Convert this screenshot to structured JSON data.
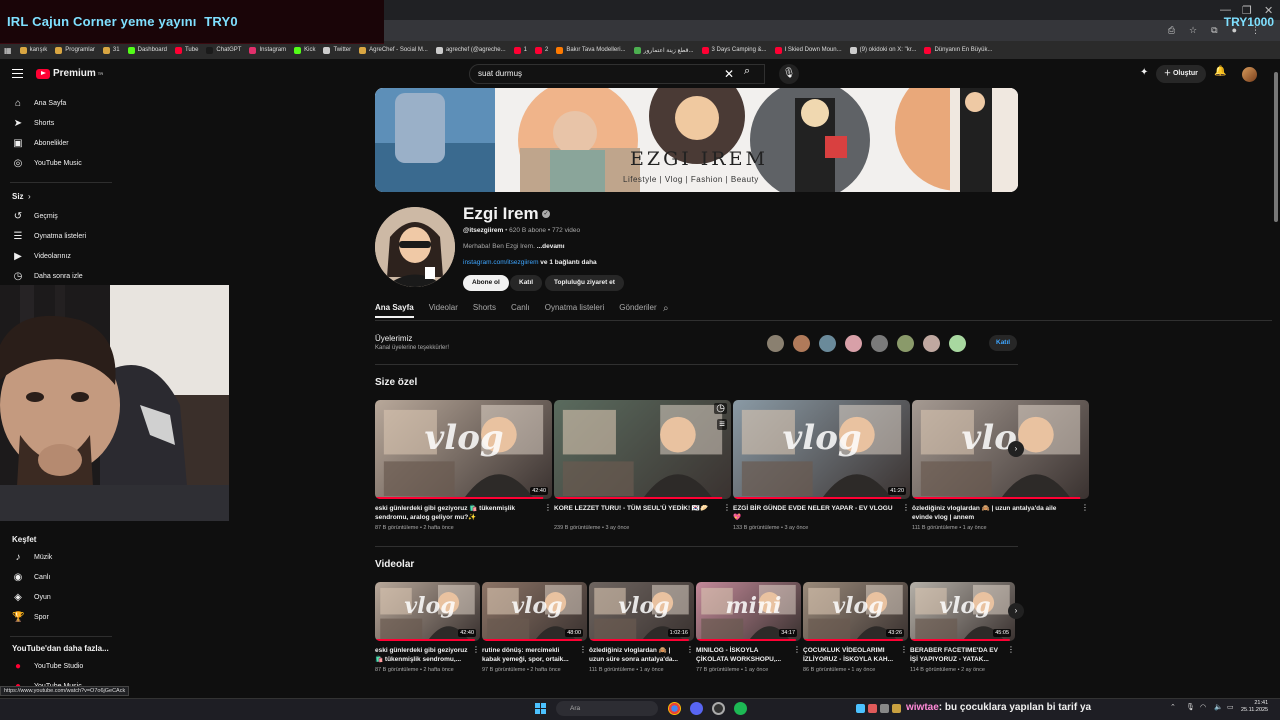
{
  "stream_overlay": {
    "title": "IRL Cajun Corner yeme yayını",
    "goal_current": "TRY0",
    "goal_target": "TRY1000"
  },
  "bookmarks": [
    {
      "label": "karışık",
      "color": "#d9a642"
    },
    {
      "label": "Programlar",
      "color": "#d9a642"
    },
    {
      "label": "31",
      "color": "#d9a642"
    },
    {
      "label": "Dashboard",
      "color": "#53fc18"
    },
    {
      "label": "Tube",
      "color": "#ff0033"
    },
    {
      "label": "ChatGPT",
      "color": "#1a1a1a"
    },
    {
      "label": "Instagram",
      "color": "#e1306c"
    },
    {
      "label": "Kick",
      "color": "#53fc18"
    },
    {
      "label": "Twitter",
      "color": "#cccccc"
    },
    {
      "label": "AgreChef - Social M...",
      "color": "#d9a642"
    },
    {
      "label": "agrechef (@agreche...",
      "color": "#cccccc"
    },
    {
      "label": "1",
      "color": "#ff0033"
    },
    {
      "label": "2",
      "color": "#ff0033"
    },
    {
      "label": "Bakır Tava Modelleri...",
      "color": "#ff7a00"
    },
    {
      "label": "قطع زينة اعتمارور...",
      "color": "#4caf50"
    },
    {
      "label": "3 Days Camping &...",
      "color": "#ff0033"
    },
    {
      "label": "I Skied Down Moun...",
      "color": "#ff0033"
    },
    {
      "label": "(9) okidoki on X: \"kr...",
      "color": "#cccccc"
    },
    {
      "label": "Dünyanın En Büyük...",
      "color": "#ff0033"
    }
  ],
  "header": {
    "logo_text": "Premium",
    "logo_sup": "TR",
    "search_value": "suat durmuş",
    "create_label": "Oluştur"
  },
  "sidebar": {
    "main": [
      {
        "label": "Ana Sayfa",
        "icon": "⌂"
      },
      {
        "label": "Shorts",
        "icon": "➤"
      },
      {
        "label": "Abonelikler",
        "icon": "▣"
      },
      {
        "label": "YouTube Music",
        "icon": "◎"
      }
    ],
    "you_title": "Siz",
    "you": [
      {
        "label": "Geçmiş",
        "icon": "↺"
      },
      {
        "label": "Oynatma listeleri",
        "icon": "☰"
      },
      {
        "label": "Videolarınız",
        "icon": "▶"
      },
      {
        "label": "Daha sonra izle",
        "icon": "◷"
      }
    ],
    "explore_title": "Keşfet",
    "explore": [
      {
        "label": "Müzik",
        "icon": "♪"
      },
      {
        "label": "Canlı",
        "icon": "◉"
      },
      {
        "label": "Oyun",
        "icon": "◈"
      },
      {
        "label": "Spor",
        "icon": "🏆"
      }
    ],
    "more_title": "YouTube'dan daha fazla...",
    "more": [
      {
        "label": "YouTube Studio"
      },
      {
        "label": "YouTube Music"
      }
    ]
  },
  "channel": {
    "banner_title": "EZGI IREM",
    "banner_subtitle": "Lifestyle | Vlog | Fashion | Beauty",
    "name": "Ezgi Irem",
    "handle": "@itsezgiirem",
    "meta": " • 620 B abone • 772 video",
    "desc": "Merhaba! Ben Ezgi Irem. ",
    "desc_more": "...devamı",
    "link": "instagram.com/itsezgiirem",
    "link_more": " ve 1 bağlantı daha",
    "subscribe_label": "Abone ol",
    "join_label": "Katıl",
    "community_label": "Topluluğu ziyaret et",
    "tabs": [
      "Ana Sayfa",
      "Videolar",
      "Shorts",
      "Canlı",
      "Oynatma listeleri",
      "Gönderiler"
    ],
    "members_title": "Üyelerimiz",
    "members_sub": "Kanal üyelerine teşekkürler!",
    "members_join": "Katıl"
  },
  "for_you": {
    "title": "Size özel",
    "videos": [
      {
        "title": "eski günlerdeki gibi geziyoruz 🛍️ tükenmişlik sendromu, aralog geliyor mu?✨",
        "views": "87 B görüntüleme",
        "age": "2 hafta önce",
        "duration": "42:40",
        "word": "vlog",
        "bg": "#b8a89a"
      },
      {
        "title": "KORE LEZZET TURU! - TÜM SEUL'Ü YEDİK! 🇰🇷🥟",
        "views": "239 B görüntüleme",
        "age": "3 ay önce",
        "duration": "",
        "word": "",
        "bg": "#5a6b5e"
      },
      {
        "title": "EZGİ BİR GÜNDE EVDE NELER YAPAR - EV VLOGU 💖",
        "views": "133 B görüntüleme",
        "age": "3 ay önce",
        "duration": "41:20",
        "word": "vlog",
        "bg": "#8a9aa5"
      },
      {
        "title": "özlediğiniz vloglardan 🙈 | uzun antalya'da aile evinde vlog | annem",
        "views": "111 B görüntüleme",
        "age": "1 ay önce",
        "duration": "",
        "word": "vlo",
        "bg": "#a59a92"
      }
    ]
  },
  "videos": {
    "title": "Videolar",
    "items": [
      {
        "title": "eski günlerdeki gibi geziyoruz 🛍️ tükenmişlik sendromu,...",
        "views": "87 B görüntüleme",
        "age": "2 hafta önce",
        "duration": "42:40",
        "word": "vlog",
        "bg": "#b8a89a"
      },
      {
        "title": "rutine dönüş: mercimekli kabak yemeği, spor, ortaik...",
        "views": "97 B görüntüleme",
        "age": "2 hafta önce",
        "duration": "48:00",
        "word": "vlog",
        "bg": "#8c7466"
      },
      {
        "title": "özlediğiniz vloglardan 🙈 | uzun süre sonra antalya'da...",
        "views": "111 B görüntüleme",
        "age": "1 ay önce",
        "duration": "1:02:16",
        "word": "vlog",
        "bg": "#6e6560"
      },
      {
        "title": "MINILOG - İSKOYLA ÇİKOLATA WORKSHOPU,...",
        "views": "77 B görüntüleme",
        "age": "1 ay önce",
        "duration": "34:17",
        "word": "mini",
        "bg": "#c48a9a"
      },
      {
        "title": "ÇOCUKLUK VİDEOLARIMI İZLİYORUZ - İSKOYLA KAH...",
        "views": "86 B görüntüleme",
        "age": "1 ay önce",
        "duration": "43:26",
        "word": "vlog",
        "bg": "#9a8a7a"
      },
      {
        "title": "BERABER FACETIME'DA EV İŞİ YAPIYORUZ - YATAK...",
        "views": "114 B görüntüleme",
        "age": "2 ay önce",
        "duration": "45:05",
        "word": "vlog",
        "bg": "#b5b0a8"
      }
    ]
  },
  "status_url": "https://www.youtube.com/watch?v=O7o6jGeCAck",
  "taskbar": {
    "search_placeholder": "Ara",
    "chat_user": "wiwtae",
    "chat_message": ": bu çocuklara yapılan bi tarif ya",
    "time": "21:41",
    "date": "25.11.2025"
  },
  "colors": {
    "accent": "#ff0033",
    "link": "#3ea6ff",
    "overlay_text": "#7fe0ff",
    "chat_user": "#ff8ad8"
  }
}
